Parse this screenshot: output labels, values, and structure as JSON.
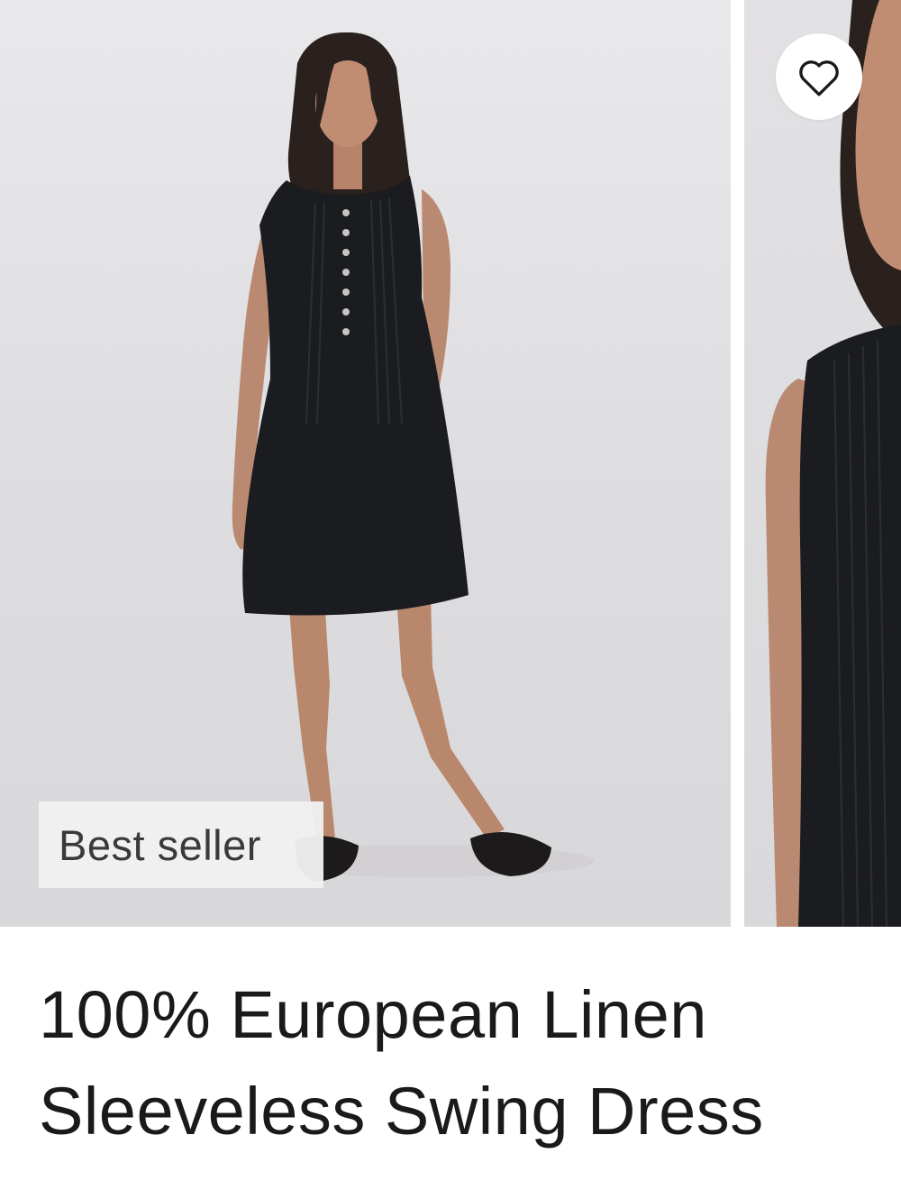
{
  "product": {
    "badge": "Best seller",
    "title": "100% European Linen Sleeveless Swing Dress",
    "favorite_icon": "heart-outline-icon",
    "images": [
      {
        "name": "product-photo-full-length"
      },
      {
        "name": "product-photo-detail-closeup"
      }
    ]
  },
  "colors": {
    "text": "#1a1a1a",
    "badge_bg": "#f0f0f0",
    "photo_bg": "#e3e2e4",
    "dress": "#1b1c1f"
  }
}
